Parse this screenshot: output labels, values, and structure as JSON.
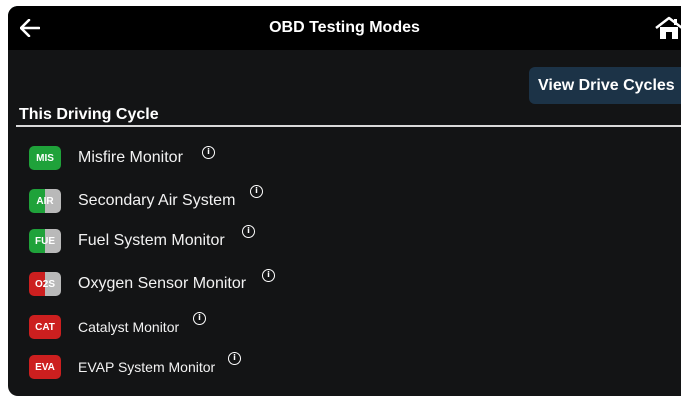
{
  "header": {
    "title": "OBD Testing Modes",
    "back_icon": "arrow-left-icon",
    "home_icon": "home-icon"
  },
  "actions": {
    "view_drive_cycles": "View Drive Cycles"
  },
  "section": {
    "title": "This Driving Cycle"
  },
  "monitors": [
    {
      "code": "MIS",
      "label": "Misfire Monitor",
      "status": "complete",
      "badge_color": "#1fa23a",
      "info_icon": "info-icon"
    },
    {
      "code": "AIR",
      "label": "Secondary Air System",
      "status": "partial",
      "badge_color": "#1fa23a",
      "info_icon": "info-icon"
    },
    {
      "code": "FUE",
      "label": "Fuel System Monitor",
      "status": "partial",
      "badge_color": "#1fa23a",
      "info_icon": "info-icon"
    },
    {
      "code": "O2S",
      "label": "Oxygen Sensor Monitor",
      "status": "partial",
      "badge_color": "#cc1f1f",
      "info_icon": "info-icon"
    },
    {
      "code": "CAT",
      "label": "Catalyst Monitor",
      "status": "incomplete",
      "badge_color": "#cc1f1f",
      "info_icon": "info-icon"
    },
    {
      "code": "EVA",
      "label": "EVAP System Monitor",
      "status": "incomplete",
      "badge_color": "#cc1f1f",
      "info_icon": "info-icon"
    }
  ],
  "colors": {
    "background": "#131415",
    "titlebar": "#000000",
    "button": "#1c3347",
    "complete": "#1fa23a",
    "incomplete": "#cc1f1f",
    "pending_half": "#b9b9b9"
  }
}
